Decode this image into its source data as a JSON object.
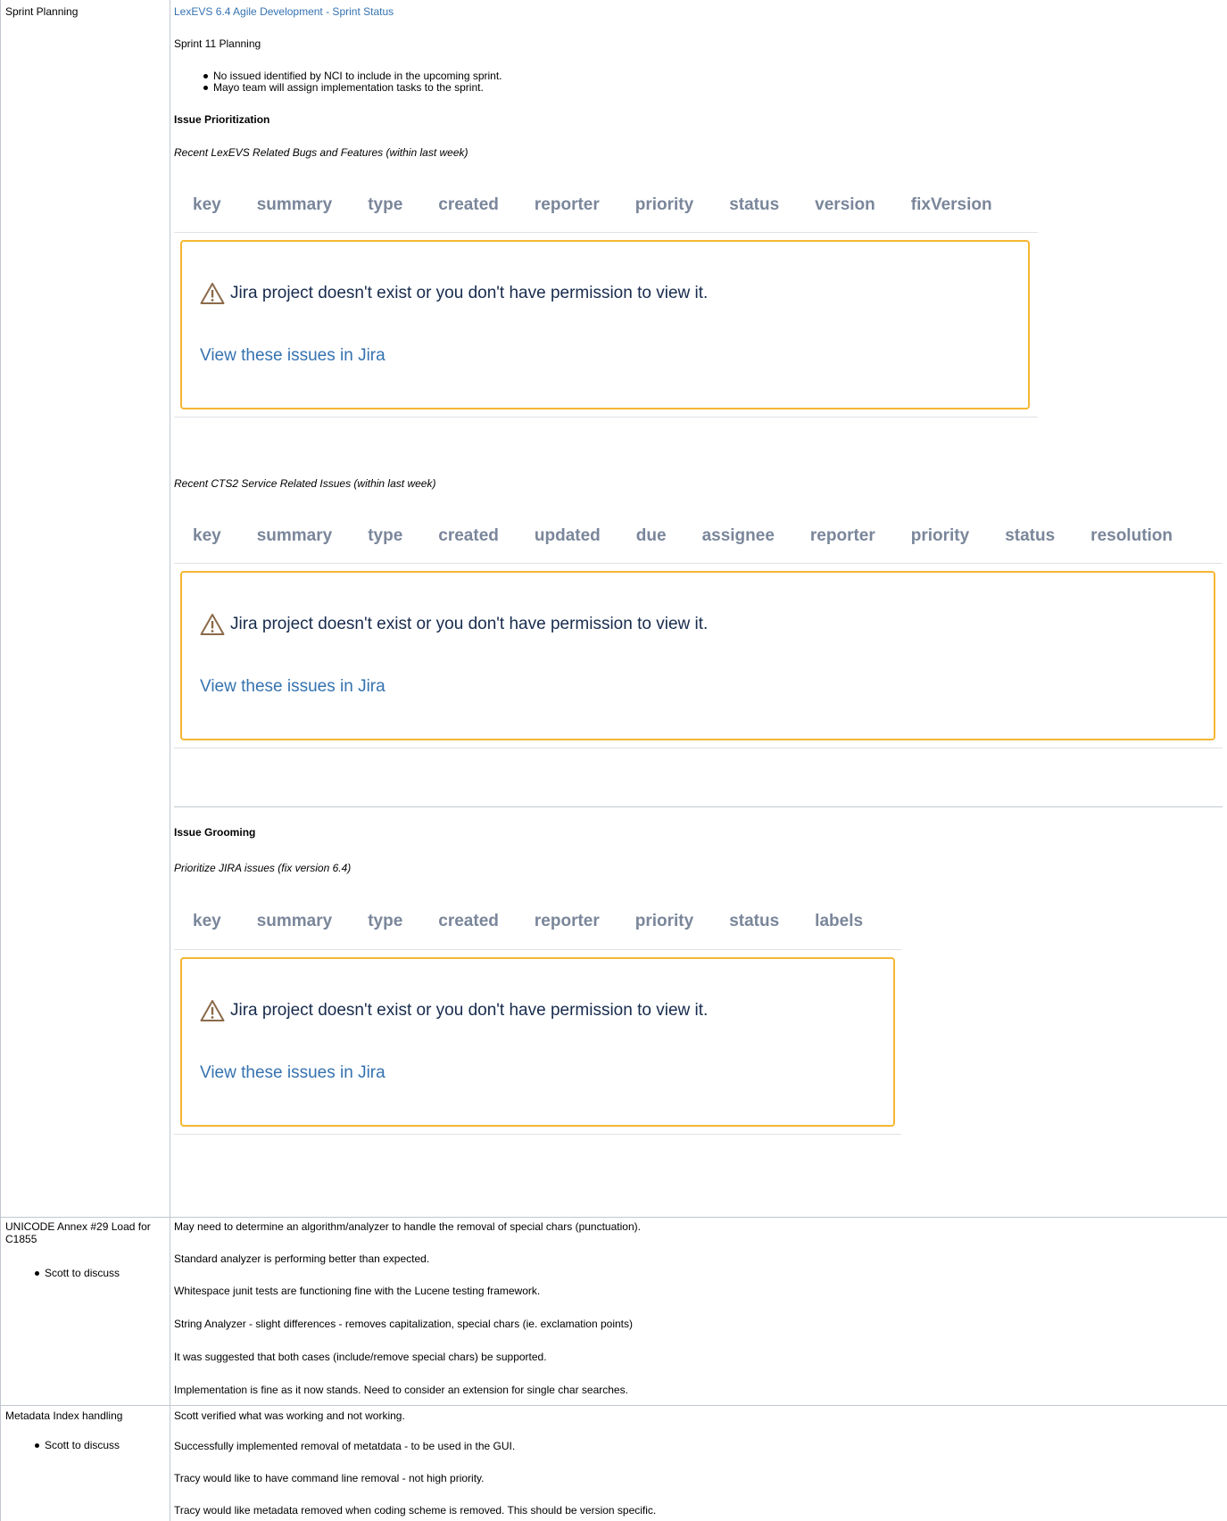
{
  "rows": [
    {
      "topic": "Sprint Planning",
      "topic_bullets": [],
      "link_text": "LexEVS 6.4 Agile Development - Sprint Status",
      "sprint_title": "Sprint 11 Planning",
      "bullets": [
        "No issued identified by NCI to include in the upcoming sprint.",
        "Mayo team will assign implementation tasks to the sprint."
      ],
      "issue_prioritization_heading": "Issue Prioritization",
      "recent_bugs_label": "Recent LexEVS Related Bugs and Features (within last week)",
      "recent_cts2_label": "Recent CTS2 Service Related Issues (within last week)",
      "issue_grooming_heading": "Issue Grooming",
      "prioritize_label": "Prioritize JIRA issues (fix version 6.4)"
    },
    {
      "topic": "UNICODE Annex #29 Load for C1855",
      "topic_bullets": [
        "Scott to discuss"
      ],
      "notes": [
        "May need to determine an algorithm/analyzer to handle the removal of special chars (punctuation).",
        "Standard analyzer is performing better than expected.",
        "Whitespace junit tests are functioning fine with the Lucene testing framework.",
        "String Analyzer - slight differences - removes capitalization, special chars (ie. exclamation points)",
        "It was suggested that both cases (include/remove special chars) be supported.",
        "Implementation is fine as it now stands. Need to consider an extension for single char searches."
      ]
    },
    {
      "topic": "Metadata Index handling",
      "topic_bullets": [
        "Scott to discuss"
      ],
      "notes": [
        "Scott verified what was working and not working.",
        "Successfully implemented removal of metatdata - to be used in the GUI.",
        "Tracy would like to have command line removal - not high priority.",
        "Tracy would like metadata removed when coding scheme is removed. This should be version specific."
      ]
    }
  ],
  "jira_tables": [
    {
      "columns": [
        "key",
        "summary",
        "type",
        "created",
        "reporter",
        "priority",
        "status",
        "version",
        "fixVersion"
      ],
      "error_message": "Jira project doesn't exist or you don't have permission to view it.",
      "view_link": "View these issues in Jira"
    },
    {
      "columns": [
        "key",
        "summary",
        "type",
        "created",
        "updated",
        "due",
        "assignee",
        "reporter",
        "priority",
        "status",
        "resolution"
      ],
      "error_message": "Jira project doesn't exist or you don't have permission to view it.",
      "view_link": "View these issues in Jira"
    },
    {
      "columns": [
        "key",
        "summary",
        "type",
        "created",
        "reporter",
        "priority",
        "status",
        "labels"
      ],
      "error_message": "Jira project doesn't exist or you don't have permission to view it.",
      "view_link": "View these issues in Jira"
    }
  ],
  "colors": {
    "link": "#3572b0",
    "warning_border": "#f6b632",
    "header_text": "#7a869a",
    "table_border": "#c1c7d0"
  },
  "icons": [
    "warning-icon"
  ]
}
